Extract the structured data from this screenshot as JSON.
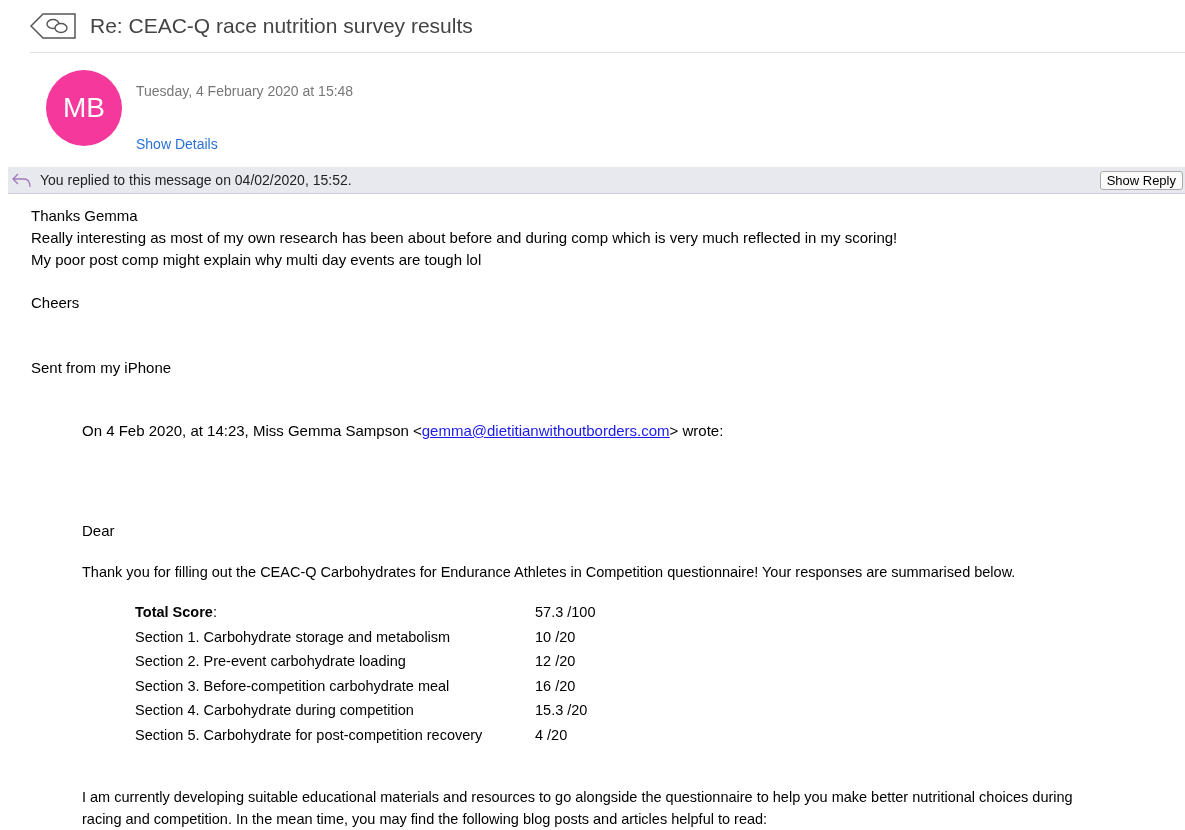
{
  "header": {
    "title": "Re: CEAC-Q race nutrition survey results"
  },
  "sender": {
    "initials": "MB",
    "date": "Tuesday, 4 February 2020 at 15:48",
    "details_link": "Show Details"
  },
  "reply_banner": {
    "text": "You replied to this message on 04/02/2020, 15:52.",
    "button": "Show Reply"
  },
  "body": {
    "lines": [
      "Thanks Gemma",
      "Really interesting as most of my own research has been about before and during comp which is very much reflected in my scoring!",
      "My poor post comp might explain why multi day events are tough lol"
    ],
    "signoff": "Cheers",
    "signature": "Sent from my iPhone"
  },
  "quote": {
    "intro_before": "On 4 Feb 2020, at 14:23, Miss Gemma Sampson <",
    "email": "gemma@dietitianwithoutborders.com",
    "intro_after": "> wrote:",
    "greeting": "Dear",
    "thanks": "Thank you for filling out the CEAC-Q Carbohydrates for Endurance Athletes in Competition questionnaire! Your responses are summarised below.",
    "scores": [
      {
        "label": "**Total Score**:",
        "value": "57.3 /100"
      },
      {
        "label": "Section 1. Carbohydrate storage and metabolism",
        "value": "10 /20"
      },
      {
        "label": "Section 2. Pre-event carbohydrate loading",
        "value": "12 /20"
      },
      {
        "label": "Section 3. Before-competition carbohydrate meal",
        "value": "16 /20"
      },
      {
        "label": "Section 4. Carbohydrate during competition",
        "value": "15.3 /20"
      },
      {
        "label": "Section 5. Carbohydrate for post-competition recovery",
        "value": "4 /20"
      }
    ],
    "closing": "I am currently developing suitable educational materials and resources to go alongside the questionnaire to help you make better nutritional choices during racing and competition. In the mean time, you may find the following blog posts and articles helpful to read:"
  }
}
